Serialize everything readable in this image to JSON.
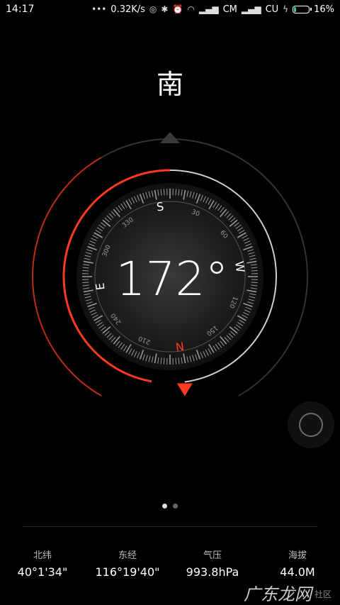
{
  "status_bar": {
    "time": "14:17",
    "network_speed": "0.32K/s",
    "carrier_1": "CM",
    "carrier_2": "CU",
    "battery_percent": "16%",
    "battery_level": 0.16,
    "icons": [
      "more-dots-icon",
      "hotspot-icon",
      "bluetooth-icon",
      "alarm-icon",
      "wifi-icon",
      "signal-icon",
      "signal-icon",
      "charging-icon",
      "battery-icon"
    ]
  },
  "compass": {
    "direction": "南",
    "heading_text": "172°",
    "heading_degrees": 172,
    "cardinals": {
      "n": "N",
      "e": "E",
      "s": "S",
      "w": "W"
    },
    "dial_numbers": [
      "30",
      "60",
      "120",
      "150",
      "210",
      "240",
      "300",
      "330"
    ],
    "accent_color": "#ff3b1f",
    "ring_color": "#cfcfcf"
  },
  "pager": {
    "pages": 2,
    "active": 0
  },
  "info": [
    {
      "label": "北纬",
      "value": "40°1'34\""
    },
    {
      "label": "东经",
      "value": "116°19'40\""
    },
    {
      "label": "气压",
      "value": "993.8hPa"
    },
    {
      "label": "海拔",
      "value": "44.0M"
    }
  ],
  "watermark": {
    "main": "广东龙网",
    "sub": "社区"
  }
}
